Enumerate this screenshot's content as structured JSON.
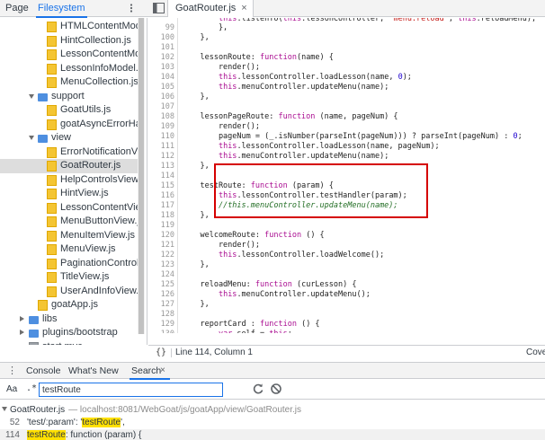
{
  "navigator": {
    "tabs": {
      "page": "Page",
      "filesystem": "Filesystem"
    },
    "tree": [
      {
        "kind": "file",
        "name": "HTMLContentModel.js",
        "level": 3
      },
      {
        "kind": "file",
        "name": "HintCollection.js",
        "level": 3
      },
      {
        "kind": "file",
        "name": "LessonContentModel.js",
        "level": 3
      },
      {
        "kind": "file",
        "name": "LessonInfoModel.js",
        "level": 3
      },
      {
        "kind": "file",
        "name": "MenuCollection.js",
        "level": 3
      },
      {
        "kind": "folder",
        "name": "support",
        "level": 2,
        "expanded": true
      },
      {
        "kind": "file",
        "name": "GoatUtils.js",
        "level": 3
      },
      {
        "kind": "file",
        "name": "goatAsyncErrorHandler.",
        "level": 3
      },
      {
        "kind": "folder",
        "name": "view",
        "level": 2,
        "expanded": true
      },
      {
        "kind": "file",
        "name": "ErrorNotificationView.js",
        "level": 3
      },
      {
        "kind": "file",
        "name": "GoatRouter.js",
        "level": 3,
        "selected": true
      },
      {
        "kind": "file",
        "name": "HelpControlsView.js",
        "level": 3
      },
      {
        "kind": "file",
        "name": "HintView.js",
        "level": 3
      },
      {
        "kind": "file",
        "name": "LessonContentView.js",
        "level": 3
      },
      {
        "kind": "file",
        "name": "MenuButtonView.js",
        "level": 3
      },
      {
        "kind": "file",
        "name": "MenuItemView.js",
        "level": 3
      },
      {
        "kind": "file",
        "name": "MenuView.js",
        "level": 3
      },
      {
        "kind": "file",
        "name": "PaginationControlView.",
        "level": 3
      },
      {
        "kind": "file",
        "name": "TitleView.js",
        "level": 3
      },
      {
        "kind": "file",
        "name": "UserAndInfoView.js",
        "level": 3
      },
      {
        "kind": "file",
        "name": "goatApp.js",
        "level": 2
      },
      {
        "kind": "folder",
        "name": "libs",
        "level": 1,
        "expanded": false
      },
      {
        "kind": "folder",
        "name": "plugins/bootstrap",
        "level": 1,
        "expanded": false
      },
      {
        "kind": "file-gray",
        "name": "start.mvc",
        "level": 1
      }
    ]
  },
  "editor": {
    "tab_label": "GoatRouter.js",
    "lines": [
      {
        "n": "99",
        "html": "        },",
        "partial_top": true
      },
      {
        "n": "100",
        "html": "    },"
      },
      {
        "n": "101",
        "html": ""
      },
      {
        "n": "102",
        "html": "    lessonRoute: <span class=\"k\">function</span>(name) {"
      },
      {
        "n": "103",
        "html": "        render();"
      },
      {
        "n": "104",
        "html": "        <span class=\"k\">this</span>.lessonController.loadLesson(name, <span class=\"p\">0</span>);"
      },
      {
        "n": "105",
        "html": "        <span class=\"k\">this</span>.menuController.updateMenu(name);"
      },
      {
        "n": "106",
        "html": "    },"
      },
      {
        "n": "107",
        "html": ""
      },
      {
        "n": "108",
        "html": "    lessonPageRoute: <span class=\"k\">function</span> (name, pageNum) {"
      },
      {
        "n": "109",
        "html": "        render();"
      },
      {
        "n": "110",
        "html": "        pageNum = (_.isNumber(parseInt(pageNum))) ? parseInt(pageNum) : <span class=\"p\">0</span>;"
      },
      {
        "n": "111",
        "html": "        <span class=\"k\">this</span>.lessonController.loadLesson(name, pageNum);"
      },
      {
        "n": "112",
        "html": "        <span class=\"k\">this</span>.menuController.updateMenu(name);"
      },
      {
        "n": "113",
        "html": "    },"
      },
      {
        "n": "114",
        "html": ""
      },
      {
        "n": "115",
        "html": "    testRoute: <span class=\"k\">function</span> (param) {"
      },
      {
        "n": "116",
        "html": "        <span class=\"k\">this</span>.lessonController.testHandler(param);"
      },
      {
        "n": "117",
        "html": "        <span class=\"c\">//this.menuController.updateMenu(name);</span>"
      },
      {
        "n": "118",
        "html": "    },"
      },
      {
        "n": "119",
        "html": ""
      },
      {
        "n": "120",
        "html": "    welcomeRoute: <span class=\"k\">function</span> () {"
      },
      {
        "n": "121",
        "html": "        render();"
      },
      {
        "n": "122",
        "html": "        <span class=\"k\">this</span>.lessonController.loadWelcome();"
      },
      {
        "n": "123",
        "html": "    },"
      },
      {
        "n": "124",
        "html": ""
      },
      {
        "n": "125",
        "html": "    reloadMenu: <span class=\"k\">function</span> (curLesson) {"
      },
      {
        "n": "126",
        "html": "        <span class=\"k\">this</span>.menuController.updateMenu();"
      },
      {
        "n": "127",
        "html": "    },"
      },
      {
        "n": "128",
        "html": ""
      },
      {
        "n": "129",
        "html": "    reportCard : <span class=\"k\">function</span> () {"
      },
      {
        "n": "130",
        "html": "        <span class=\"k\">var</span> self = <span class=\"k\">this</span>;"
      }
    ],
    "top_partial_html": "        <span class=\"k\">this</span>.listenTo(<span class=\"k\">this</span>.lessonController, <span class=\"s\">'menu:reload'</span>, <span class=\"k\">this</span>.reloadMenu);"
  },
  "status_bar": {
    "format_icon": "{}",
    "cursor_position": "Line 114, Column 1",
    "coverage_label": "Cove"
  },
  "drawer": {
    "tabs": {
      "console": "Console",
      "whats_new": "What's New",
      "search": "Search"
    },
    "close_glyph": "×"
  },
  "search": {
    "match_case_label": "Aa",
    "regex_label": ".*",
    "query": "testRoute",
    "results": {
      "file_name": "GoatRouter.js",
      "file_path": "— localhost:8081/WebGoat/js/goatApp/view/GoatRouter.js",
      "matches": [
        {
          "line": "52",
          "before": "'test/:param': '",
          "match": "testRoute",
          "after": "',"
        },
        {
          "line": "114",
          "before": "",
          "match": "testRoute",
          "after": ": function (param) {"
        }
      ]
    }
  },
  "colors": {
    "accent": "#1a73e8",
    "highlight_box": "#d50000",
    "search_match": "#ffe000",
    "js_file": "#f4c533",
    "folder": "#4e8fe0"
  }
}
